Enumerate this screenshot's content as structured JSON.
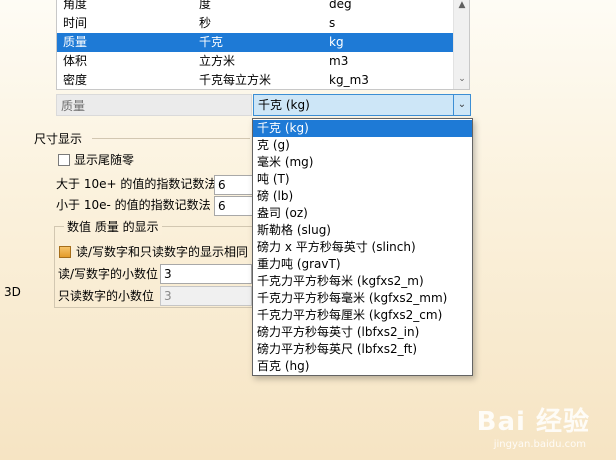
{
  "table": {
    "rows": [
      {
        "name": "角度",
        "unit": "度",
        "symbol": "deg"
      },
      {
        "name": "时间",
        "unit": "秒",
        "symbol": "s"
      },
      {
        "name": "质量",
        "unit": "千克",
        "symbol": "kg",
        "selected": true
      },
      {
        "name": "体积",
        "unit": "立方米",
        "symbol": "m3"
      },
      {
        "name": "密度",
        "unit": "千克每立方米",
        "symbol": "kg_m3"
      }
    ]
  },
  "quantity": {
    "label": "质量",
    "selected_unit": "千克 (kg)"
  },
  "dropdown": {
    "options": [
      "千克 (kg)",
      "克 (g)",
      "毫米 (mg)",
      "吨 (T)",
      "磅 (lb)",
      "盎司 (oz)",
      "斯勒格 (slug)",
      "磅力 x 平方秒每英寸 (slinch)",
      "重力吨 (gravT)",
      "千克力平方秒每米 (kgfxs2_m)",
      "千克力平方秒每毫米 (kgfxs2_mm)",
      "千克力平方秒每厘米 (kgfxs2_cm)",
      "磅力平方秒每英寸 (lbfxs2_in)",
      "磅力平方秒每英尺 (lbfxs2_ft)",
      "百克 (hg)"
    ],
    "highlighted_index": 0
  },
  "dimension_display": {
    "title": "尺寸显示",
    "show_trailing_zeros_label": "显示尾随零",
    "show_trailing_zeros": false,
    "greater_exp_label": "大于 10e+ 的值的指数记数法",
    "greater_exp_value": "6",
    "less_exp_label": "小于 10e- 的值的指数记数法",
    "less_exp_value": "6"
  },
  "numeric_display": {
    "title": "数值 质量 的显示",
    "same_display_label": "读/写数字和只读数字的显示相同",
    "same_display": true,
    "rw_decimals_label": "读/写数字的小数位",
    "rw_decimals_value": "3",
    "ro_decimals_label": "只读数字的小数位",
    "ro_decimals_value": "3"
  },
  "left_edge": {
    "label_3d": "3D"
  },
  "watermark": {
    "brand": "Bai 经验",
    "url": "jingyan.baidu.com"
  }
}
